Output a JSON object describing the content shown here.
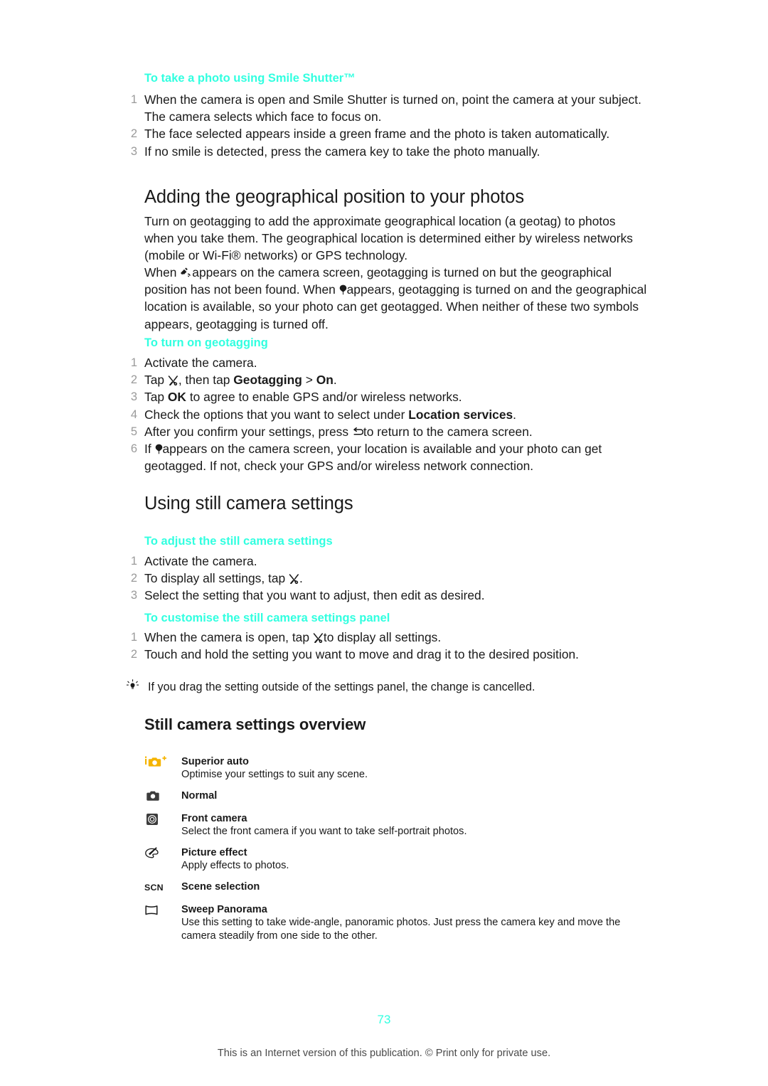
{
  "document": {
    "page_number": "73",
    "footer_note": "This is an Internet version of this publication. © Print only for private use.",
    "accent_color": "#31ffe0",
    "superior_auto_icon_color": "#f5b400"
  },
  "sections": [
    {
      "id": "smile-shutter",
      "heading": "To take a photo using Smile Shutter™",
      "steps": [
        "When the camera is open and Smile Shutter is turned on, point the camera at your subject. The camera selects which face to focus on.",
        "The face selected appears inside a green frame and the photo is taken automatically.",
        "If no smile is detected, press the camera key to take the photo manually."
      ],
      "numbers": [
        "1",
        "2",
        "3"
      ]
    },
    {
      "id": "geo-position",
      "title": "Adding the geographical position to your photos",
      "paragraph1": "Turn on geotagging to add the approximate geographical location (a geotag) to photos when you take them. The geographical location is determined either by wireless networks (mobile or Wi-Fi® networks) or GPS technology.",
      "paragraph2_a": "When",
      "paragraph2_b": "appears on the camera screen, geotagging is turned on but the geographical position has not been found. When",
      "paragraph2_c": "appears, geotagging is turned on and the geographical location is available, so your photo can get geotagged. When neither of these two symbols appears, geotagging is turned off."
    },
    {
      "id": "turn-on-geotagging",
      "heading": "To turn on geotagging",
      "numbers": [
        "1",
        "2",
        "3",
        "4",
        "5",
        "6"
      ],
      "step1": "Activate the camera.",
      "step2_a": "Tap",
      "step2_b": ", then tap",
      "step2_bold1": "Geotagging",
      "step2_c": ">",
      "step2_bold2": "On",
      "step2_d": ".",
      "step3_a": "Tap",
      "step3_bold": "OK",
      "step3_b": "to agree to enable GPS and/or wireless networks.",
      "step4_a": "Check the options that you want to select under",
      "step4_bold": "Location services",
      "step4_b": ".",
      "step5_a": "After you confirm your settings, press",
      "step5_b": "to return to the camera screen.",
      "step6_a": "If",
      "step6_b": "appears on the camera screen, your location is available and your photo can get geotagged. If not, check your GPS and/or wireless network connection."
    },
    {
      "id": "using-still-camera-settings",
      "title": "Using still camera settings",
      "heading_adjust": "To adjust the still camera settings",
      "adjust_numbers": [
        "1",
        "2",
        "3"
      ],
      "adjust_step1": "Activate the camera.",
      "adjust_step2_a": "To display all settings, tap",
      "adjust_step2_b": ".",
      "adjust_step3": "Select the setting that you want to adjust, then edit as desired.",
      "heading_customise": "To customise the still camera settings panel",
      "customise_numbers": [
        "1",
        "2"
      ],
      "customise_step1_a": "When the camera is open, tap",
      "customise_step1_b": "to display all settings.",
      "customise_step2": "Touch and hold the setting you want to move and drag it to the desired position.",
      "tip": "If you drag the setting outside of the settings panel, the change is cancelled."
    },
    {
      "id": "still-camera-settings-overview",
      "title": "Still camera settings overview",
      "items": [
        {
          "icon": "superior-auto-icon",
          "title": "Superior auto",
          "desc": "Optimise your settings to suit any scene."
        },
        {
          "icon": "camera-icon",
          "title": "Normal",
          "desc": ""
        },
        {
          "icon": "front-camera-icon",
          "title": "Front camera",
          "desc": "Select the front camera if you want to take self-portrait photos."
        },
        {
          "icon": "picture-effect-icon",
          "title": "Picture effect",
          "desc": "Apply effects to photos."
        },
        {
          "icon": "scene-selection-icon",
          "title": "Scene selection",
          "desc": "",
          "icon_text": "SCN"
        },
        {
          "icon": "sweep-panorama-icon",
          "title": "Sweep Panorama",
          "desc": "Use this setting to take wide-angle, panoramic photos. Just press the camera key and move the camera steadily from one side to the other."
        }
      ]
    }
  ]
}
